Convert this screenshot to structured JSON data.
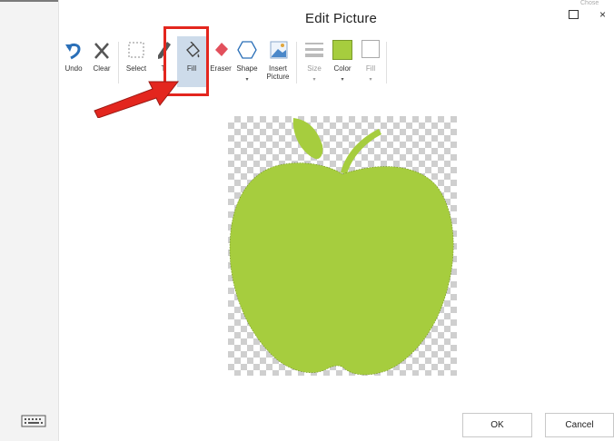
{
  "window": {
    "title": "Edit Picture",
    "ghost_label": "Chose"
  },
  "toolbar": {
    "undo": "Undo",
    "clear": "Clear",
    "select": "Select",
    "trim": "T",
    "fill": "Fill",
    "eraser": "Eraser",
    "shape": "Shape",
    "insert_picture_line1": "Insert",
    "insert_picture_line2": "Picture",
    "size": "Size",
    "color": "Color",
    "fill_style": "Fill",
    "selected_color": "#a6cd3e"
  },
  "canvas": {
    "image": "apple-image",
    "apple_color": "#a6cd3e"
  },
  "footer": {
    "ok": "OK",
    "cancel": "Cancel"
  },
  "icons": [
    "undo-icon",
    "clear-icon",
    "select-icon",
    "pencil-icon",
    "fill-bucket-icon",
    "eraser-icon",
    "shape-icon",
    "insert-picture-icon",
    "size-icon",
    "color-swatch-icon",
    "fill-style-icon",
    "keyboard-icon"
  ],
  "annotation": {
    "highlight_color": "#e3261e"
  }
}
